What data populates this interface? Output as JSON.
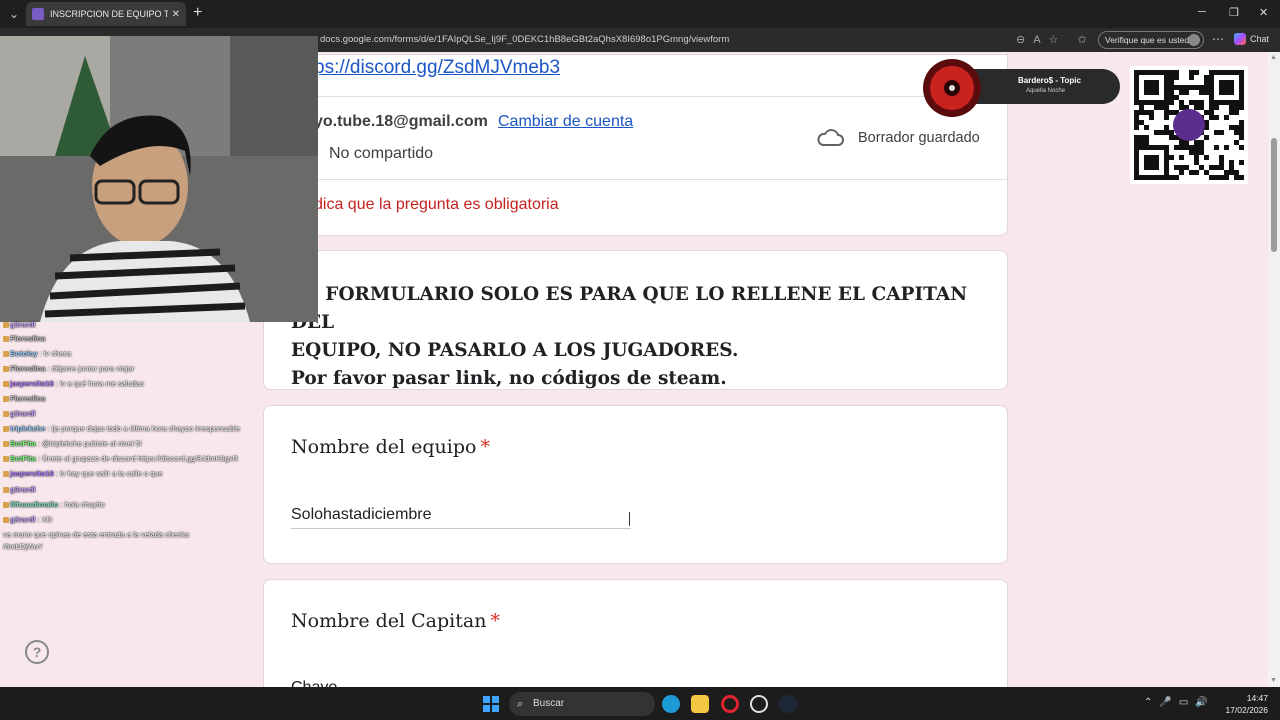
{
  "browser": {
    "tab_title": "INSCRIPCION DE EQUIPO TORNEO",
    "tab_close": "✕",
    "new_tab": "+",
    "url": "docs.google.com/forms/d/e/1FAIpQLSe_Ij9F_0DEKC1hB8eGBt2aQhsX8I698o1PGmng/viewform",
    "verify_label": "Verifique que es usted",
    "chat_label": "Chat"
  },
  "form": {
    "discord_link": "ps://discord.gg/ZsdMJVmeb3",
    "email": "yo.tube.18@gmail.com",
    "switch_account": "Cambiar de cuenta",
    "not_shared": "No compartido",
    "draft_status": "Borrador guardado",
    "required_note": "dica que la pregunta es obligatoria",
    "notice_line1": "TE FORMULARIO SOLO ES PARA QUE LO RELLENE EL CAPITAN DEL",
    "notice_line2": "EQUIPO,  NO PASARLO A LOS JUGADORES.",
    "notice_line3": "Por favor pasar link, no códigos de steam.",
    "questions": [
      {
        "title": "Nombre del equipo",
        "required_mark": "*",
        "answer": "Solohastadiciembre"
      },
      {
        "title": "Nombre del Capitan",
        "required_mark": "*",
        "answer": "Chayo"
      }
    ],
    "help_label": "?"
  },
  "overlay": {
    "chat": [
      {
        "user": "g3rardl",
        "msg": "",
        "color": "#c8a6ff"
      },
      {
        "user": "Floreslina",
        "msg": "",
        "color": "#c0c0c0"
      },
      {
        "user": "Botolsy",
        "msg": ": lv checa",
        "color": "#9ad0ff"
      },
      {
        "user": "Floreslina",
        "msg": ": déjame juntar para viajar",
        "color": "#c0c0c0"
      },
      {
        "user": "jaspercito16",
        "msg": ": lv a qué hora me saludas",
        "color": "#b07cff"
      },
      {
        "user": "Floreslina",
        "msg": "",
        "color": "#c0c0c0"
      },
      {
        "user": "g3rardl",
        "msg": "",
        "color": "#c8a6ff"
      },
      {
        "user": "triplekche",
        "msg": ": ija porque dejas todo a última hora chayoo irresponsable",
        "color": "#9ad0ff"
      },
      {
        "user": "BotFita",
        "msg": ": @triplekche pubiste al nivel 5!",
        "color": "#7dff7d"
      },
      {
        "user": "BotFita",
        "msg": ": Únete al grupazo de discord https://discord.gg/8JdmK8gvR",
        "color": "#7dff7d"
      },
      {
        "user": "jaspercito16",
        "msg": ": lv hay que salir a la calle o que",
        "color": "#b07cff"
      },
      {
        "user": "g3rardl",
        "msg": "",
        "color": "#c8a6ff"
      },
      {
        "user": "lilfuaudimalio",
        "msg": ": hola chayito",
        "color": "#80e0c0"
      },
      {
        "user": "g3rardl",
        "msg": ": XD",
        "color": "#c8a6ff"
      },
      {
        "user": "",
        "msg": "va mano que opinas de esta entrada a la velada checka",
        "color": "#ffffff"
      },
      {
        "user": "",
        "msg": "/6mbDjWuY",
        "color": "#ffffff"
      }
    ],
    "music_title": "Bardero$ - Topic",
    "music_subtitle": "Aquella Noche"
  },
  "taskbar": {
    "search_placeholder": "Buscar",
    "time": "14:47",
    "date": "17/02/2026"
  }
}
